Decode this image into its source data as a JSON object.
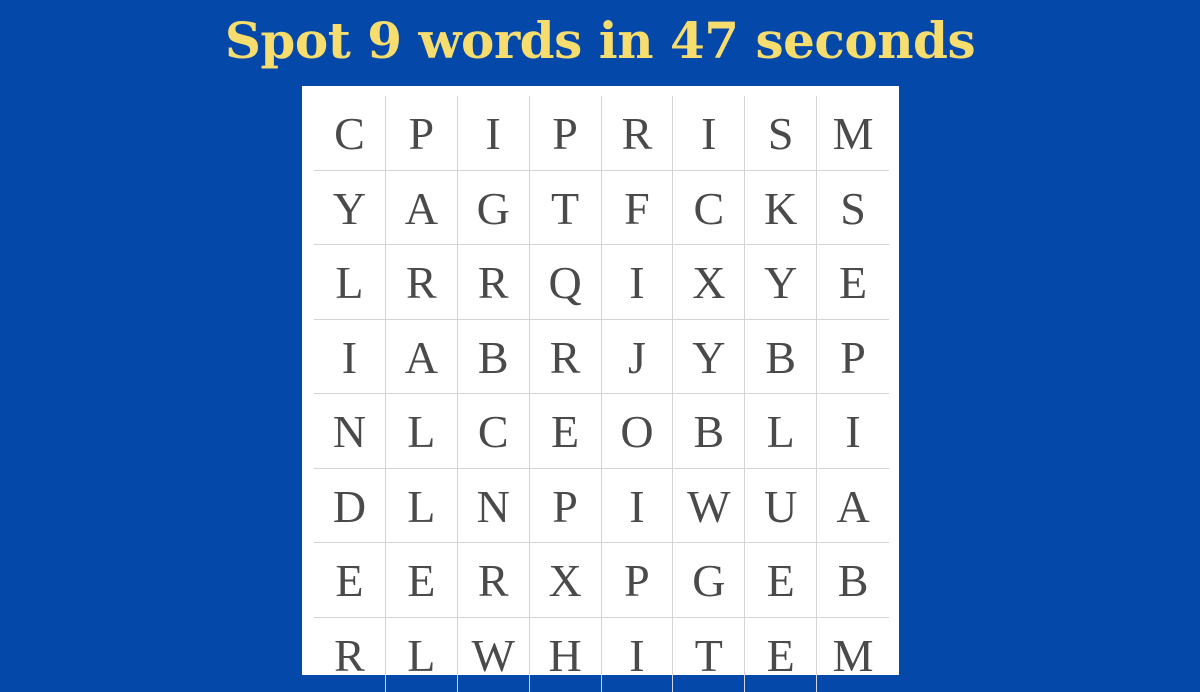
{
  "title": "Spot 9 words in 47 seconds",
  "colors": {
    "background": "#0448a9",
    "title": "#f7dd6e",
    "board": "#ffffff",
    "letter": "#4a4a4a",
    "gridline": "#d4d4d4"
  },
  "grid": [
    [
      "C",
      "P",
      "I",
      "P",
      "R",
      "I",
      "S",
      "M"
    ],
    [
      "Y",
      "A",
      "G",
      "T",
      "F",
      "C",
      "K",
      "S"
    ],
    [
      "L",
      "R",
      "R",
      "Q",
      "I",
      "X",
      "Y",
      "E"
    ],
    [
      "I",
      "A",
      "B",
      "R",
      "J",
      "Y",
      "B",
      "P"
    ],
    [
      "N",
      "L",
      "C",
      "E",
      "O",
      "B",
      "L",
      "I"
    ],
    [
      "D",
      "L",
      "N",
      "P",
      "I",
      "W",
      "U",
      "A"
    ],
    [
      "E",
      "E",
      "R",
      "X",
      "P",
      "G",
      "E",
      "B"
    ],
    [
      "R",
      "L",
      "W",
      "H",
      "I",
      "T",
      "E",
      "M"
    ]
  ]
}
